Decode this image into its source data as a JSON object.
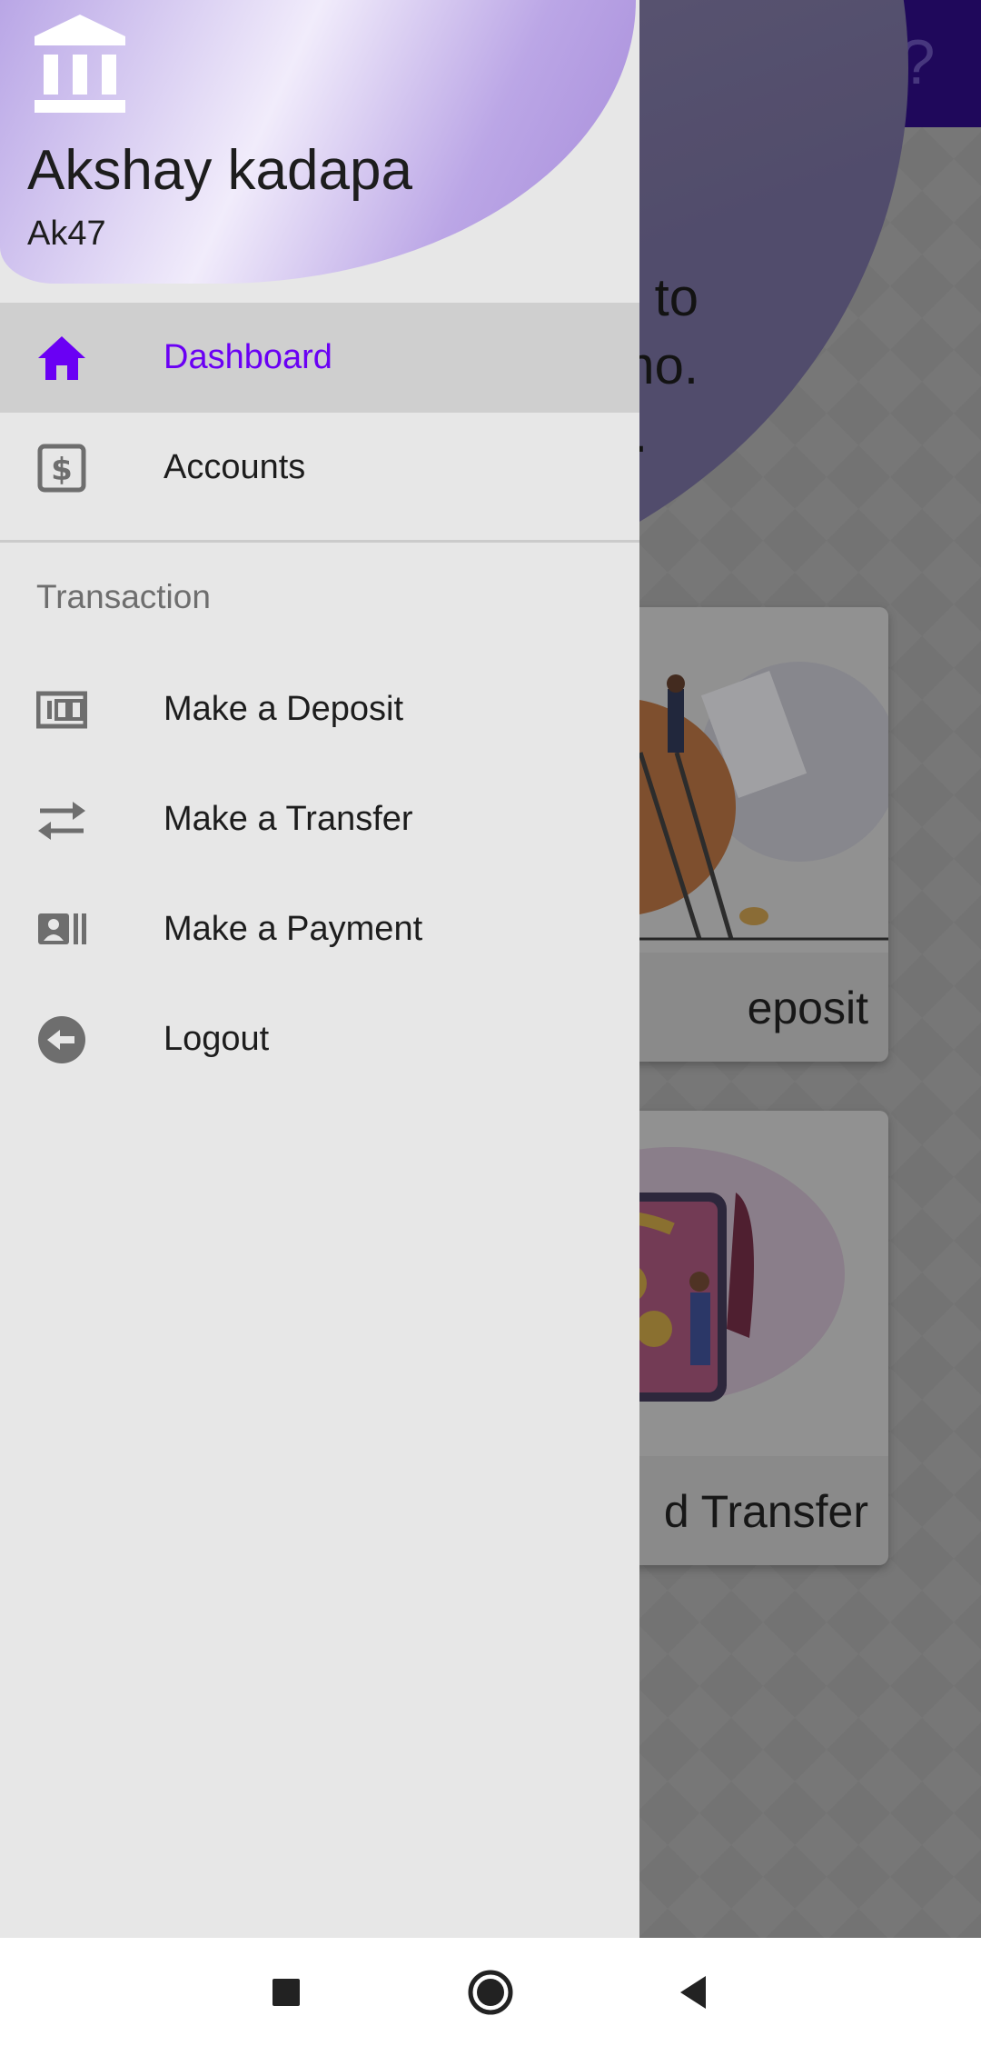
{
  "background_app": {
    "welcome_text": "g,\nne to\nemo.\nay.",
    "cards": [
      {
        "label": "eposit"
      },
      {
        "label": "d Transfer"
      }
    ],
    "help_icon": "question-mark-icon"
  },
  "drawer": {
    "header": {
      "icon": "bank-icon",
      "name": "Akshay kadapa",
      "username": "Ak47"
    },
    "main_items": [
      {
        "label": "Dashboard",
        "icon": "home-icon",
        "active": true
      },
      {
        "label": "Accounts",
        "icon": "dollar-box-icon",
        "active": false
      }
    ],
    "section_title": "Transaction",
    "transaction_items": [
      {
        "label": "Make a Deposit",
        "icon": "deposit-icon"
      },
      {
        "label": "Make a Transfer",
        "icon": "transfer-arrows-icon"
      },
      {
        "label": "Make a Payment",
        "icon": "payment-card-icon"
      },
      {
        "label": "Logout",
        "icon": "logout-icon"
      }
    ]
  },
  "colors": {
    "accent": "#6a00f4",
    "topbar": "#2a0b7a",
    "drawer_bg": "#e7e7e7",
    "active_item_bg": "#cfcfcf"
  },
  "system_nav": {
    "buttons": [
      "recents-square-icon",
      "home-circle-icon",
      "back-triangle-icon"
    ]
  }
}
